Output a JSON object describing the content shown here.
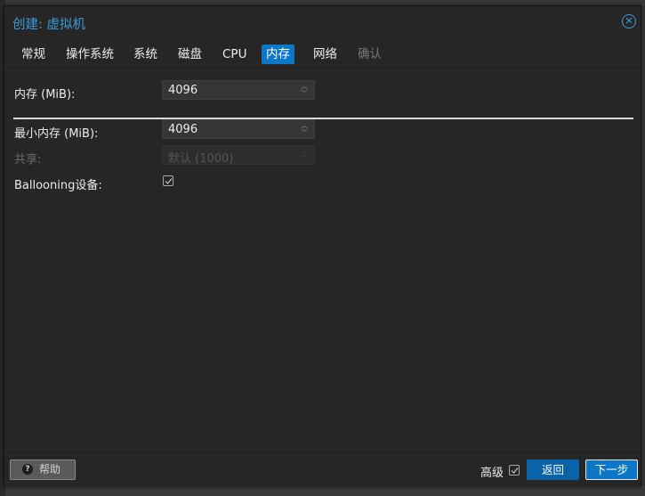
{
  "window": {
    "title": "创建: 虚拟机",
    "close_icon": "close-circle-icon"
  },
  "tabs": [
    {
      "label": "常规",
      "state": "normal"
    },
    {
      "label": "操作系统",
      "state": "normal"
    },
    {
      "label": "系统",
      "state": "normal"
    },
    {
      "label": "磁盘",
      "state": "normal"
    },
    {
      "label": "CPU",
      "state": "normal"
    },
    {
      "label": "内存",
      "state": "active"
    },
    {
      "label": "网络",
      "state": "normal"
    },
    {
      "label": "确认",
      "state": "disabled"
    }
  ],
  "memory": {
    "label": "内存 (MiB):",
    "value": "4096"
  },
  "min_memory": {
    "label": "最小内存 (MiB):",
    "value": "4096"
  },
  "shares": {
    "label": "共享:",
    "placeholder": "默认 (1000)"
  },
  "ballooning": {
    "label": "Ballooning设备:",
    "checked": true
  },
  "footer": {
    "help_label": "帮助",
    "advanced_label": "高级",
    "advanced_checked": true,
    "back_label": "返回",
    "next_label": "下一步"
  },
  "colors": {
    "accent": "#0c76c7",
    "title": "#3c9bda",
    "background": "#262626"
  }
}
